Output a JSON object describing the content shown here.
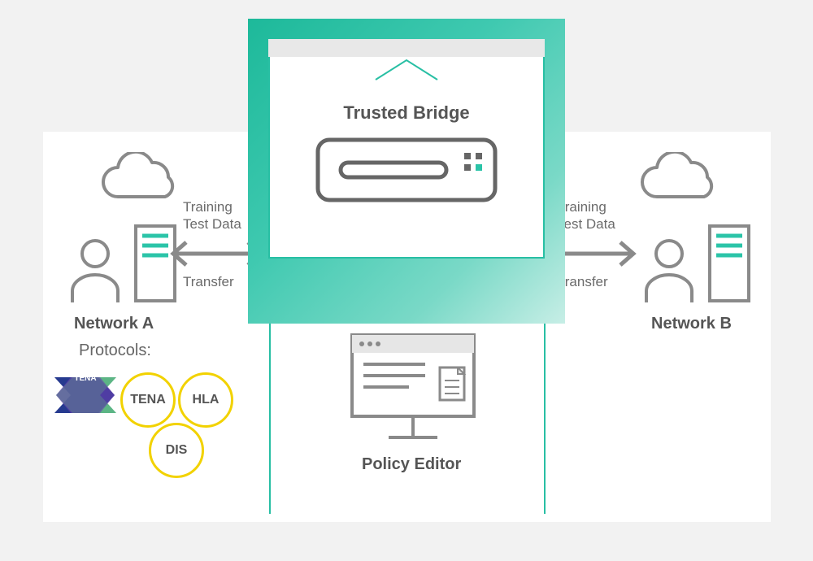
{
  "center": {
    "bridge_title": "Trusted Bridge",
    "policy_label": "Policy Editor"
  },
  "left": {
    "network_label": "Network A",
    "protocols_label": "Protocols:",
    "arrow_top1": "Training",
    "arrow_top2": "Test Data",
    "arrow_bottom": "Transfer",
    "protocol_circles": {
      "tena": "TENA",
      "hla": "HLA",
      "dis": "DIS"
    },
    "tena_logo_text": "TENA"
  },
  "right": {
    "network_label": "Network B",
    "arrow_top1": "Training",
    "arrow_top2": "Test Data",
    "arrow_bottom": "Transfer"
  }
}
